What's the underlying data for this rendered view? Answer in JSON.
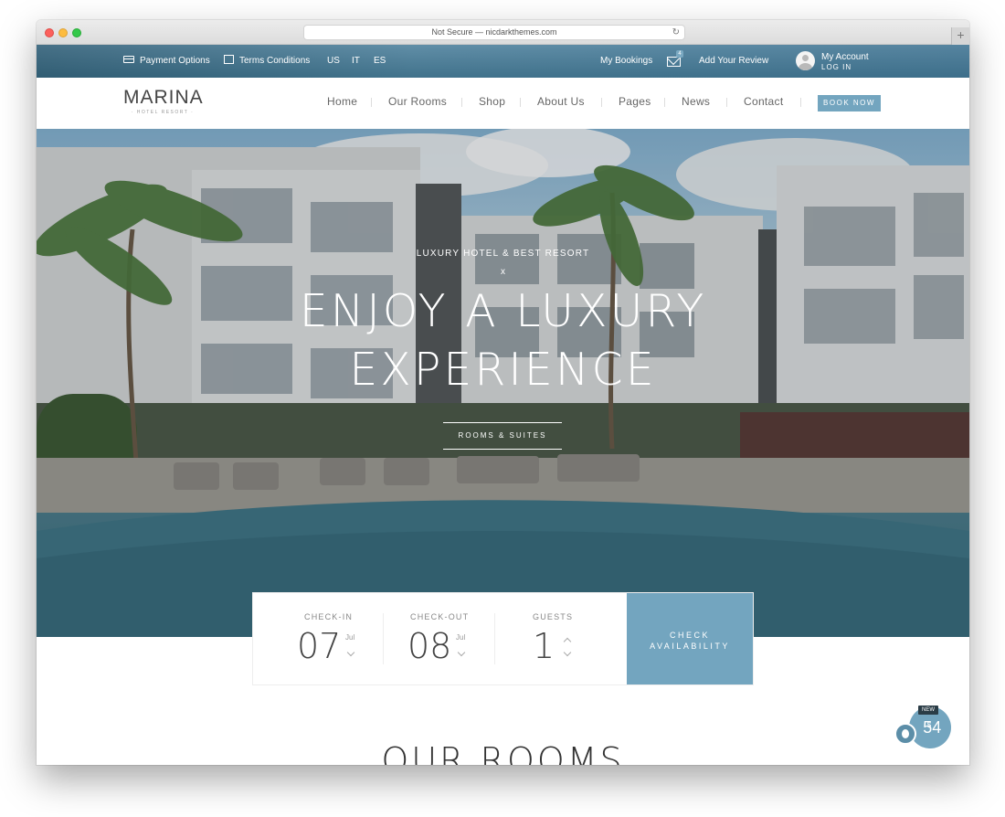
{
  "browser": {
    "url_text": "Not Secure — nicdarkthemes.com",
    "reload_icon": "reload-icon",
    "new_tab_label": "+"
  },
  "topbar": {
    "payment": "Payment Options",
    "terms": "Terms Conditions",
    "languages": [
      "US",
      "IT",
      "ES"
    ],
    "bookings": "My Bookings",
    "mail_count": "4",
    "review": "Add Your Review",
    "account_name": "My Account",
    "account_login": "LOG IN"
  },
  "header": {
    "logo_main": "MARINA",
    "logo_sub": "· HOTEL RESORT ·",
    "nav": [
      "Home",
      "Our Rooms",
      "Shop",
      "About Us",
      "Pages",
      "News",
      "Contact"
    ],
    "book_now": "BOOK NOW"
  },
  "hero": {
    "kicker": "LUXURY HOTEL & BEST RESORT",
    "separator": "x",
    "title_line1": "ENJOY A LUXURY",
    "title_line2": "EXPERIENCE",
    "button": "ROOMS & SUITES"
  },
  "booking": {
    "checkin_label": "CHECK-IN",
    "checkin_day": "07",
    "checkin_month": "Jul",
    "checkout_label": "CHECK-OUT",
    "checkout_day": "08",
    "checkout_month": "Jul",
    "guests_label": "GUESTS",
    "guests_value": "1",
    "check_line1": "CHECK",
    "check_line2": "AVAILABILITY"
  },
  "rooms": {
    "title": "OUR ROOMS"
  },
  "cart": {
    "badge": "NEW",
    "currency": "$",
    "amount": "54"
  },
  "colors": {
    "accent": "#73a5bf",
    "dark": "#2a3c46"
  }
}
